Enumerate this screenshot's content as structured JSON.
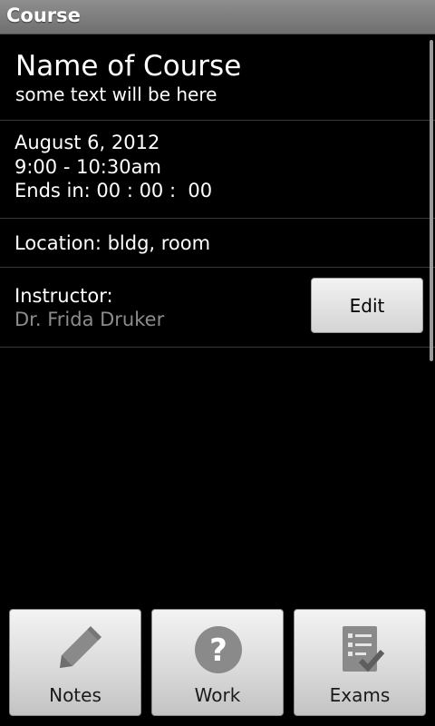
{
  "titlebar": {
    "title": "Course"
  },
  "course": {
    "name": "Name of Course",
    "subtitle": "some text will be here"
  },
  "schedule": {
    "date": "August 6, 2012",
    "time": "9:00 - 10:30am",
    "ends_in": "Ends in: 00 : 00 :  00"
  },
  "location": {
    "text": "Location: bldg, room"
  },
  "instructor": {
    "label": "Instructor:",
    "name": "Dr. Frida Druker",
    "edit_label": "Edit"
  },
  "bottom_nav": {
    "notes": {
      "label": "Notes",
      "icon": "pencil-icon"
    },
    "work": {
      "label": "Work",
      "icon": "question-icon"
    },
    "exams": {
      "label": "Exams",
      "icon": "checklist-icon"
    }
  },
  "colors": {
    "titlebar": "#7f7f7f",
    "background": "#000000",
    "instructor_name": "#8c8c8c",
    "button_face": "#e6e6e6"
  }
}
